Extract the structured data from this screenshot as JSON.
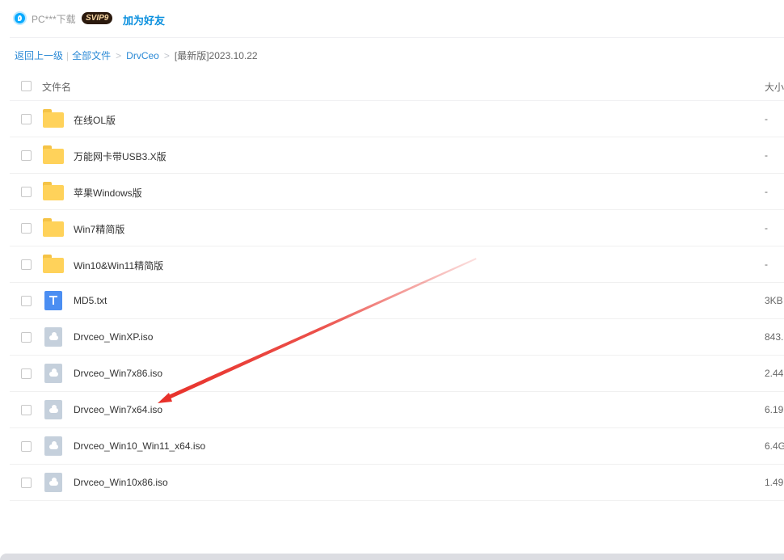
{
  "header": {
    "user_name": "PC***下载",
    "vip_badge": "SVIP9",
    "add_friend": "加为好友"
  },
  "breadcrumb": {
    "back": "返回上一级",
    "all_files": "全部文件",
    "folder": "DrvCeo",
    "separator": ">",
    "current": "[最新版]2023.10.22"
  },
  "columns": {
    "name": "文件名",
    "size": "大小"
  },
  "files": [
    {
      "name": "在线OL版",
      "size": "-",
      "icon": "folder-icon"
    },
    {
      "name": "万能网卡带USB3.X版",
      "size": "-",
      "icon": "folder-icon"
    },
    {
      "name": "苹果Windows版",
      "size": "-",
      "icon": "folder-icon"
    },
    {
      "name": "Win7精简版",
      "size": "-",
      "icon": "folder-icon"
    },
    {
      "name": "Win10&Win11精简版",
      "size": "-",
      "icon": "folder-icon"
    },
    {
      "name": "MD5.txt",
      "size": "3KB",
      "icon": "txt-file-icon"
    },
    {
      "name": "Drvceo_WinXP.iso",
      "size": "843.",
      "icon": "iso-file-icon"
    },
    {
      "name": "Drvceo_Win7x86.iso",
      "size": "2.44",
      "icon": "iso-file-icon"
    },
    {
      "name": "Drvceo_Win7x64.iso",
      "size": "6.19",
      "icon": "iso-file-icon"
    },
    {
      "name": "Drvceo_Win10_Win11_x64.iso",
      "size": "6.4G",
      "icon": "iso-file-icon"
    },
    {
      "name": "Drvceo_Win10x86.iso",
      "size": "1.49",
      "icon": "iso-file-icon"
    }
  ],
  "colors": {
    "link": "#2c8ad6",
    "folder": "#ffd25a",
    "txt_icon": "#4b8ef2",
    "iso_icon": "#c5d0dc",
    "annotation_arrow": "#e8312a"
  }
}
